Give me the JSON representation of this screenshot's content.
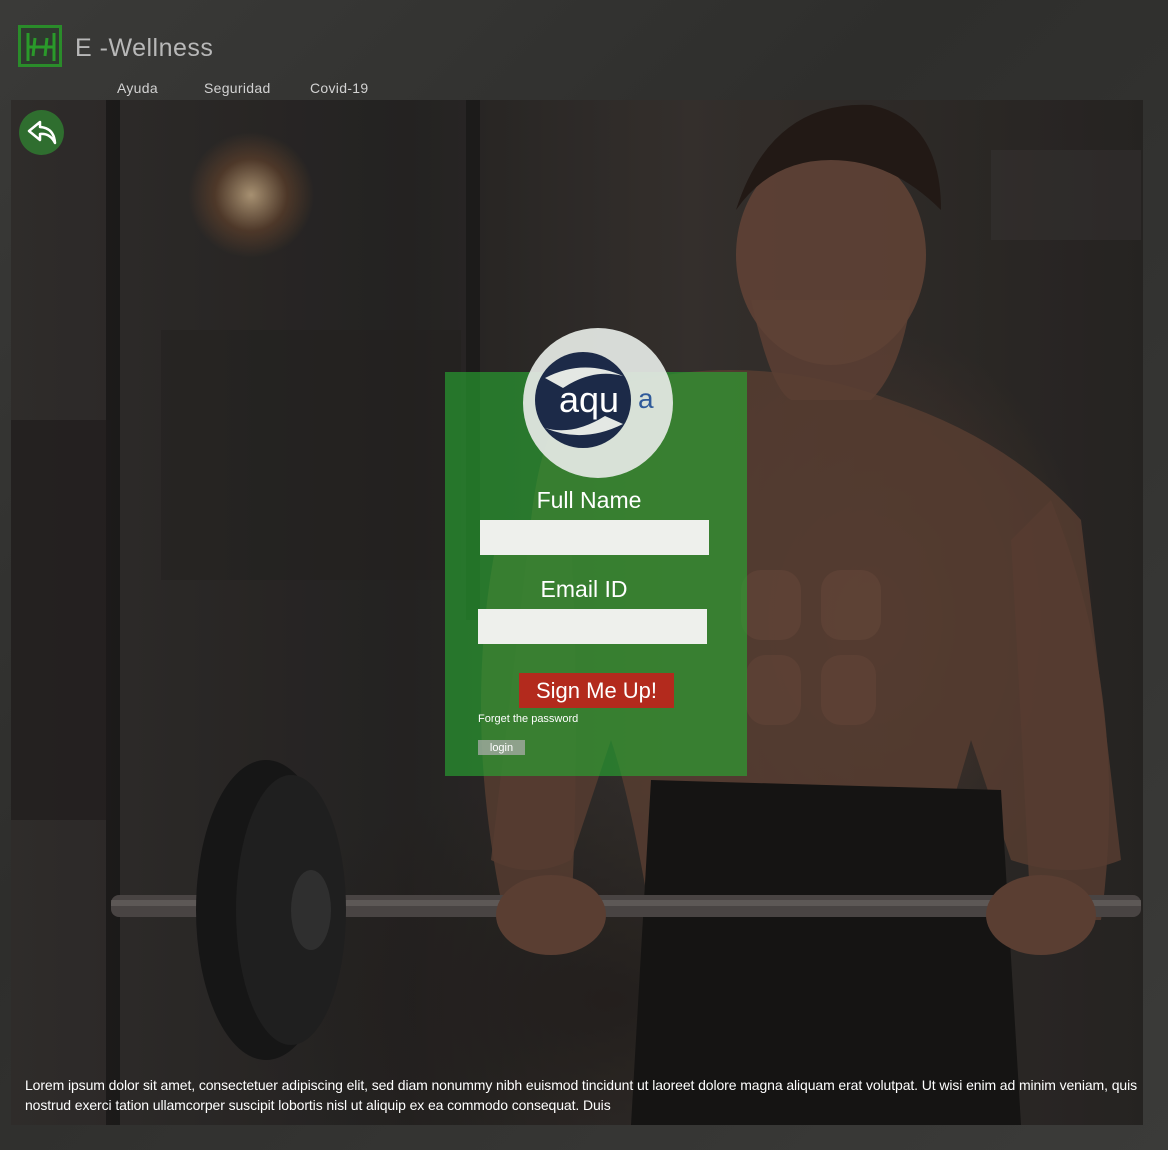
{
  "header": {
    "brand": "E -Wellness",
    "logo_icon": "dumbbell-icon",
    "nav": [
      {
        "label": "Ayuda"
      },
      {
        "label": "Seguridad"
      },
      {
        "label": "Covid-19"
      }
    ]
  },
  "back_icon": "reply-arrow-icon",
  "form": {
    "logo": {
      "main": "aqu",
      "suffix": "a"
    },
    "full_name_label": "Full Name",
    "full_name_value": "",
    "email_label": "Email ID",
    "email_value": "",
    "signup_label": "Sign Me Up!",
    "forget_label": "Forget the password",
    "login_label": "login"
  },
  "footer": {
    "text": "Lorem ipsum dolor sit amet, consectetuer adipiscing elit, sed diam nonummy nibh euismod tincidunt ut laoreet dolore magna aliquam erat volutpat. Ut wisi enim ad minim veniam, quis nostrud exerci tation ullamcorper suscipit lobortis nisl ut aliquip ex ea commodo consequat. Duis"
  },
  "colors": {
    "brand_green": "#2a8c2a",
    "panel_green": "#28aa32",
    "signup_red": "#b32a1d",
    "logo_navy": "#1c2a48"
  }
}
